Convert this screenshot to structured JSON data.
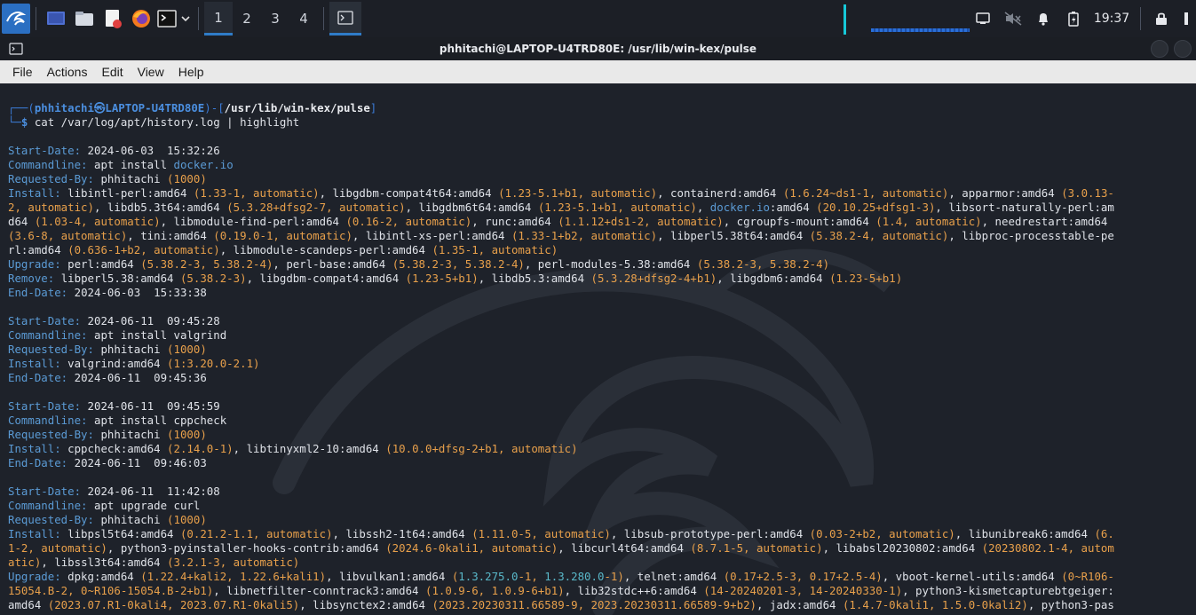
{
  "panel": {
    "workspaces": [
      "1",
      "2",
      "3",
      "4"
    ],
    "active_workspace": "1",
    "clock": "19:37",
    "launchers": [
      "kali-menu-icon",
      "desktop-icon",
      "file-manager-icon",
      "text-editor-icon",
      "firefox-icon",
      "terminal-icon"
    ]
  },
  "window": {
    "title": "phhitachi@LAPTOP-U4TRD80E: /usr/lib/win-kex/pulse"
  },
  "menubar": {
    "items": [
      "File",
      "Actions",
      "Edit",
      "View",
      "Help"
    ]
  },
  "terminal": {
    "prompt": {
      "user": "phhitachi",
      "host": "LAPTOP-U4TRD80E",
      "cwd": "/usr/lib/win-kex/pulse",
      "command": "cat /var/log/apt/history.log | highlight"
    },
    "lines": [
      [
        [
          "k",
          "Start-Date: "
        ],
        [
          "v",
          "2024-06-03  15:32:26"
        ]
      ],
      [
        [
          "k",
          "Commandline: "
        ],
        [
          "v",
          "apt install "
        ],
        [
          "b",
          "docker.io"
        ]
      ],
      [
        [
          "k",
          "Requested-By: "
        ],
        [
          "v",
          "phhitachi "
        ],
        [
          "o",
          "(1000)"
        ]
      ],
      [
        [
          "k",
          "Install: "
        ],
        [
          "v",
          "libintl-perl:amd64 "
        ],
        [
          "o",
          "(1.33-1, automatic)"
        ],
        [
          "v",
          ", libgdbm-compat4t64:amd64 "
        ],
        [
          "o",
          "(1.23-5.1+b1, automatic)"
        ],
        [
          "v",
          ", containerd:amd64 "
        ],
        [
          "o",
          "(1.6.24~ds1-1, automatic)"
        ],
        [
          "v",
          ", apparmor:amd64 "
        ],
        [
          "o",
          "(3.0.13-"
        ]
      ],
      [
        [
          "o",
          "2, automatic)"
        ],
        [
          "v",
          ", libdb5.3t64:amd64 "
        ],
        [
          "o",
          "(5.3.28+dfsg2-7, automatic)"
        ],
        [
          "v",
          ", libgdbm6t64:amd64 "
        ],
        [
          "o",
          "(1.23-5.1+b1, automatic)"
        ],
        [
          "v",
          ", "
        ],
        [
          "b",
          "docker.io"
        ],
        [
          "v",
          ":amd64 "
        ],
        [
          "o",
          "(20.10.25+dfsg1-3)"
        ],
        [
          "v",
          ", libsort-naturally-perl:am"
        ]
      ],
      [
        [
          "v",
          "d64 "
        ],
        [
          "o",
          "(1.03-4, automatic)"
        ],
        [
          "v",
          ", libmodule-find-perl:amd64 "
        ],
        [
          "o",
          "(0.16-2, automatic)"
        ],
        [
          "v",
          ", runc:amd64 "
        ],
        [
          "o",
          "(1.1.12+ds1-2, automatic)"
        ],
        [
          "v",
          ", cgroupfs-mount:amd64 "
        ],
        [
          "o",
          "(1.4, automatic)"
        ],
        [
          "v",
          ", needrestart:amd64 "
        ]
      ],
      [
        [
          "o",
          "(3.6-8, automatic)"
        ],
        [
          "v",
          ", tini:amd64 "
        ],
        [
          "o",
          "(0.19.0-1, automatic)"
        ],
        [
          "v",
          ", libintl-xs-perl:amd64 "
        ],
        [
          "o",
          "(1.33-1+b2, automatic)"
        ],
        [
          "v",
          ", libperl5.38t64:amd64 "
        ],
        [
          "o",
          "(5.38.2-4, automatic)"
        ],
        [
          "v",
          ", libproc-processtable-pe"
        ]
      ],
      [
        [
          "v",
          "rl:amd64 "
        ],
        [
          "o",
          "(0.636-1+b2, automatic)"
        ],
        [
          "v",
          ", libmodule-scandeps-perl:amd64 "
        ],
        [
          "o",
          "(1.35-1, automatic)"
        ]
      ],
      [
        [
          "k",
          "Upgrade: "
        ],
        [
          "v",
          "perl:amd64 "
        ],
        [
          "o",
          "(5.38.2-3, 5.38.2-4)"
        ],
        [
          "v",
          ", perl-base:amd64 "
        ],
        [
          "o",
          "(5.38.2-3, 5.38.2-4)"
        ],
        [
          "v",
          ", perl-modules-5.38:amd64 "
        ],
        [
          "o",
          "(5.38.2-3, 5.38.2-4)"
        ]
      ],
      [
        [
          "k",
          "Remove: "
        ],
        [
          "v",
          "libperl5.38:amd64 "
        ],
        [
          "o",
          "(5.38.2-3)"
        ],
        [
          "v",
          ", libgdbm-compat4:amd64 "
        ],
        [
          "o",
          "(1.23-5+b1)"
        ],
        [
          "v",
          ", libdb5.3:amd64 "
        ],
        [
          "o",
          "(5.3.28+dfsg2-4+b1)"
        ],
        [
          "v",
          ", libgdbm6:amd64 "
        ],
        [
          "o",
          "(1.23-5+b1)"
        ]
      ],
      [
        [
          "k",
          "End-Date: "
        ],
        [
          "v",
          "2024-06-03  15:33:38"
        ]
      ],
      [],
      [
        [
          "k",
          "Start-Date: "
        ],
        [
          "v",
          "2024-06-11  09:45:28"
        ]
      ],
      [
        [
          "k",
          "Commandline: "
        ],
        [
          "v",
          "apt install valgrind"
        ]
      ],
      [
        [
          "k",
          "Requested-By: "
        ],
        [
          "v",
          "phhitachi "
        ],
        [
          "o",
          "(1000)"
        ]
      ],
      [
        [
          "k",
          "Install: "
        ],
        [
          "v",
          "valgrind:amd64 "
        ],
        [
          "o",
          "(1:3.20.0-2.1)"
        ]
      ],
      [
        [
          "k",
          "End-Date: "
        ],
        [
          "v",
          "2024-06-11  09:45:36"
        ]
      ],
      [],
      [
        [
          "k",
          "Start-Date: "
        ],
        [
          "v",
          "2024-06-11  09:45:59"
        ]
      ],
      [
        [
          "k",
          "Commandline: "
        ],
        [
          "v",
          "apt install cppcheck"
        ]
      ],
      [
        [
          "k",
          "Requested-By: "
        ],
        [
          "v",
          "phhitachi "
        ],
        [
          "o",
          "(1000)"
        ]
      ],
      [
        [
          "k",
          "Install: "
        ],
        [
          "v",
          "cppcheck:amd64 "
        ],
        [
          "o",
          "(2.14.0-1)"
        ],
        [
          "v",
          ", libtinyxml2-10:amd64 "
        ],
        [
          "o",
          "(10.0.0+dfsg-2+b1, automatic)"
        ]
      ],
      [
        [
          "k",
          "End-Date: "
        ],
        [
          "v",
          "2024-06-11  09:46:03"
        ]
      ],
      [],
      [
        [
          "k",
          "Start-Date: "
        ],
        [
          "v",
          "2024-06-11  11:42:08"
        ]
      ],
      [
        [
          "k",
          "Commandline: "
        ],
        [
          "v",
          "apt upgrade curl"
        ]
      ],
      [
        [
          "k",
          "Requested-By: "
        ],
        [
          "v",
          "phhitachi "
        ],
        [
          "o",
          "(1000)"
        ]
      ],
      [
        [
          "k",
          "Install: "
        ],
        [
          "v",
          "libpsl5t64:amd64 "
        ],
        [
          "o",
          "(0.21.2-1.1, automatic)"
        ],
        [
          "v",
          ", libssh2-1t64:amd64 "
        ],
        [
          "o",
          "(1.11.0-5, automatic)"
        ],
        [
          "v",
          ", libsub-prototype-perl:amd64 "
        ],
        [
          "o",
          "(0.03-2+b2, automatic)"
        ],
        [
          "v",
          ", libunibreak6:amd64 "
        ],
        [
          "o",
          "(6."
        ]
      ],
      [
        [
          "o",
          "1-2, automatic)"
        ],
        [
          "v",
          ", python3-pyinstaller-hooks-contrib:amd64 "
        ],
        [
          "o",
          "(2024.6-0kali1, automatic)"
        ],
        [
          "v",
          ", libcurl4t64:amd64 "
        ],
        [
          "o",
          "(8.7.1-5, automatic)"
        ],
        [
          "v",
          ", libabsl20230802:amd64 "
        ],
        [
          "o",
          "(20230802.1-4, autom"
        ]
      ],
      [
        [
          "o",
          "atic)"
        ],
        [
          "v",
          ", libssl3t64:amd64 "
        ],
        [
          "o",
          "(3.2.1-3, automatic)"
        ]
      ],
      [
        [
          "k",
          "Upgrade: "
        ],
        [
          "v",
          "dpkg:amd64 "
        ],
        [
          "o",
          "(1.22.4+kali2, 1.22.6+kali1)"
        ],
        [
          "v",
          ", libvulkan1:amd64 "
        ],
        [
          "o",
          "("
        ],
        [
          "t",
          "1.3.275.0"
        ],
        [
          "o",
          "-1, "
        ],
        [
          "t",
          "1.3.280.0"
        ],
        [
          "o",
          "-1)"
        ],
        [
          "v",
          ", telnet:amd64 "
        ],
        [
          "o",
          "(0.17+2.5-3, 0.17+2.5-4)"
        ],
        [
          "v",
          ", vboot-kernel-utils:amd64 "
        ],
        [
          "o",
          "(0~R106-"
        ]
      ],
      [
        [
          "o",
          "15054.B-2, 0~R106-15054.B-2+b1)"
        ],
        [
          "v",
          ", libnetfilter-conntrack3:amd64 "
        ],
        [
          "o",
          "(1.0.9-6, 1.0.9-6+b1)"
        ],
        [
          "v",
          ", lib32stdc++6:amd64 "
        ],
        [
          "o",
          "(14-20240201-3, 14-20240330-1)"
        ],
        [
          "v",
          ", python3-kismetcapturebtgeiger:"
        ]
      ],
      [
        [
          "v",
          "amd64 "
        ],
        [
          "o",
          "(2023.07.R1-0kali4, 2023.07.R1-0kali5)"
        ],
        [
          "v",
          ", libsynctex2:amd64 "
        ],
        [
          "o",
          "(2023.20230311.66589-9, 2023.20230311.66589-9+b2)"
        ],
        [
          "v",
          ", jadx:amd64 "
        ],
        [
          "o",
          "(1.4.7-0kali1, 1.5.0-0kali2)"
        ],
        [
          "v",
          ", python3-pas"
        ]
      ]
    ]
  }
}
